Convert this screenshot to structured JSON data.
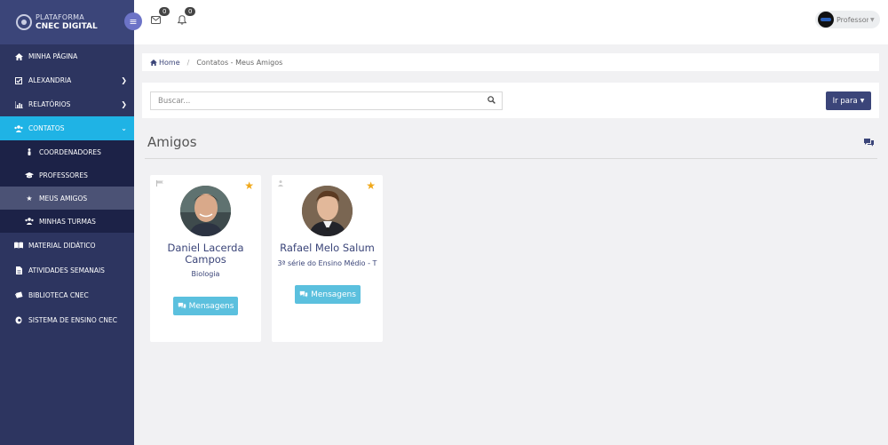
{
  "brand": {
    "line1": "PLATAFORMA",
    "line2": "CNEC DIGITAL"
  },
  "sidebar": {
    "items": [
      {
        "label": "MINHA PÁGINA",
        "icon": "home-icon"
      },
      {
        "label": "ALEXANDRIA",
        "icon": "check-square-icon"
      },
      {
        "label": "RELATÓRIOS",
        "icon": "bar-chart-icon"
      },
      {
        "label": "CONTATOS",
        "icon": "users-icon"
      },
      {
        "label": "MATERIAL DIDÁTICO",
        "icon": "book-open-icon"
      },
      {
        "label": "ATIVIDADES SEMANAIS",
        "icon": "file-icon"
      },
      {
        "label": "BIBLIOTECA CNEC",
        "icon": "books-icon"
      },
      {
        "label": "SISTEMA DE ENSINO CNEC",
        "icon": "globe-icon"
      }
    ],
    "subitems": [
      {
        "label": "COORDENADORES",
        "icon": "user-icon"
      },
      {
        "label": "PROFESSORES",
        "icon": "graduation-cap-icon"
      },
      {
        "label": "MEUS AMIGOS",
        "icon": "star-icon"
      },
      {
        "label": "MINHAS TURMAS",
        "icon": "users-icon"
      }
    ]
  },
  "topbar": {
    "messages_count": "0",
    "notifications_count": "0",
    "user_name": "Professor"
  },
  "breadcrumb": {
    "home": "Home",
    "current": "Contatos - Meus Amigos"
  },
  "search": {
    "placeholder": "Buscar...",
    "value": "",
    "go_label": "Ir para"
  },
  "section": {
    "title": "Amigos"
  },
  "friends": [
    {
      "name": "Daniel Lacerda Campos",
      "subtitle": "Biologia",
      "button": "Mensagens"
    },
    {
      "name": "Rafael Melo Salum",
      "subtitle": "3ª série do Ensino Médio - T",
      "button": "Mensagens"
    }
  ],
  "colors": {
    "sidebar": "#2d3560",
    "active": "#1fb3e5",
    "primary": "#3b4579",
    "info": "#5bc0de",
    "star": "#f0a81a"
  }
}
